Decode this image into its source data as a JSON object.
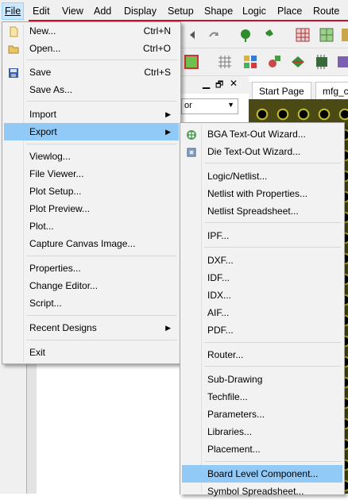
{
  "menubar": {
    "items": [
      {
        "label": "File"
      },
      {
        "label": "Edit"
      },
      {
        "label": "View"
      },
      {
        "label": "Add"
      },
      {
        "label": "Display"
      },
      {
        "label": "Setup"
      },
      {
        "label": "Shape"
      },
      {
        "label": "Logic"
      },
      {
        "label": "Place"
      },
      {
        "label": "Route"
      }
    ]
  },
  "background": {
    "tab_start_page": "Start Page",
    "tab_design": "mfg_c",
    "dropdown_value": "or",
    "window_controls": [
      "▁",
      "🗗",
      "✕"
    ]
  },
  "file_menu": {
    "items": [
      {
        "label": "New...",
        "shortcut": "Ctrl+N",
        "icon": "new-file-icon"
      },
      {
        "label": "Open...",
        "shortcut": "Ctrl+O",
        "icon": "open-folder-icon"
      },
      {
        "label": "Save",
        "shortcut": "Ctrl+S",
        "icon": "save-disk-icon"
      },
      {
        "label": "Save As...",
        "shortcut": ""
      },
      {
        "label": "Import",
        "shortcut": "",
        "submenu": true
      },
      {
        "label": "Export",
        "shortcut": "",
        "submenu": true
      },
      {
        "label": "Viewlog...",
        "shortcut": ""
      },
      {
        "label": "File Viewer...",
        "shortcut": ""
      },
      {
        "label": "Plot Setup...",
        "shortcut": ""
      },
      {
        "label": "Plot Preview...",
        "shortcut": ""
      },
      {
        "label": "Plot...",
        "shortcut": ""
      },
      {
        "label": "Capture Canvas Image...",
        "shortcut": ""
      },
      {
        "label": "Properties...",
        "shortcut": ""
      },
      {
        "label": "Change Editor...",
        "shortcut": ""
      },
      {
        "label": "Script...",
        "shortcut": ""
      },
      {
        "label": "Recent Designs",
        "shortcut": "",
        "submenu": true
      },
      {
        "label": "Exit",
        "shortcut": ""
      }
    ]
  },
  "export_menu": {
    "items": [
      {
        "label": "BGA Text-Out Wizard...",
        "icon": "bga-wizard-icon"
      },
      {
        "label": "Die Text-Out Wizard...",
        "icon": "die-wizard-icon"
      },
      {
        "label": "Logic/Netlist..."
      },
      {
        "label": "Netlist with Properties..."
      },
      {
        "label": "Netlist Spreadsheet..."
      },
      {
        "label": "IPF..."
      },
      {
        "label": "DXF..."
      },
      {
        "label": "IDF..."
      },
      {
        "label": "IDX..."
      },
      {
        "label": "AIF..."
      },
      {
        "label": "PDF..."
      },
      {
        "label": "Router..."
      },
      {
        "label": "Sub-Drawing"
      },
      {
        "label": "Techfile..."
      },
      {
        "label": "Parameters..."
      },
      {
        "label": "Libraries..."
      },
      {
        "label": "Placement..."
      },
      {
        "label": "Board Level Component..."
      },
      {
        "label": "Symbol Spreadsheet..."
      }
    ]
  },
  "colors": {
    "menu_highlight": "#91c9f7",
    "menubar_active": "#cce8ff",
    "board_bg": "#4b4a14",
    "pad_ring": "#c5c028",
    "accent_line": "#c8102e"
  }
}
